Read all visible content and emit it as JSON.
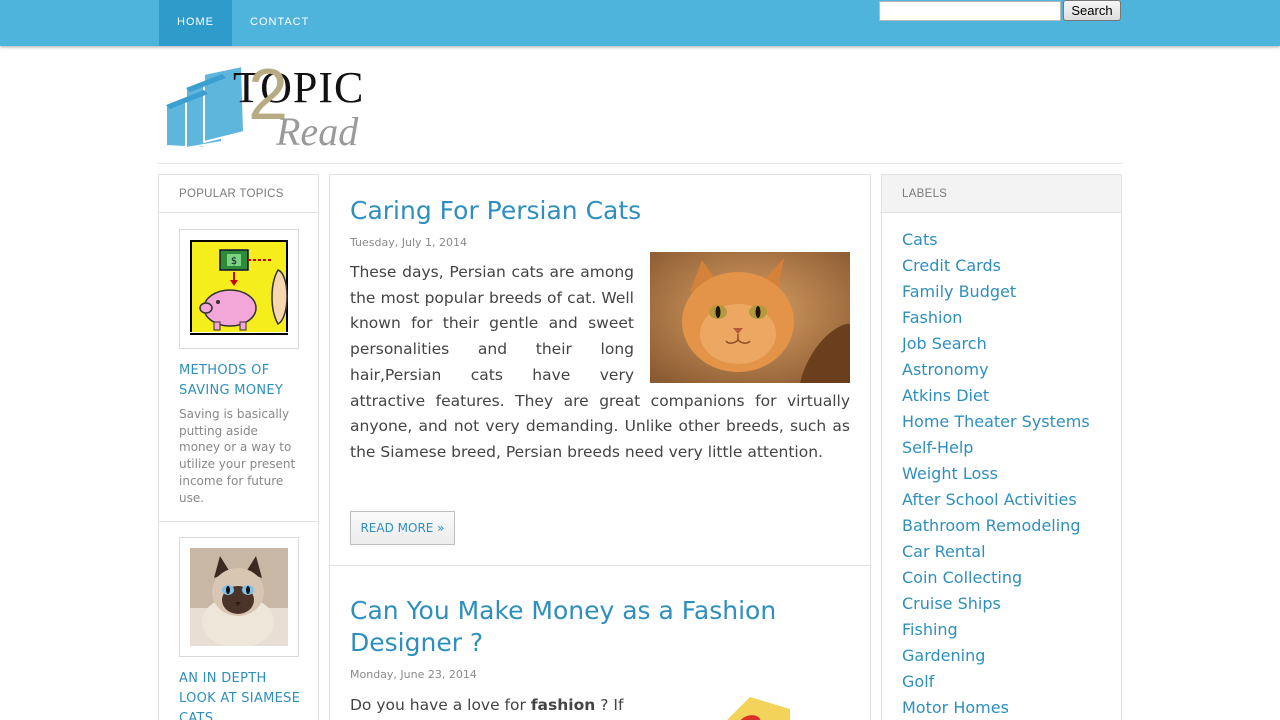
{
  "nav": {
    "items": [
      {
        "label": "HOME",
        "active": true
      },
      {
        "label": "CONTACT",
        "active": false
      }
    ],
    "search": {
      "value": "",
      "button_label": "Search"
    },
    "colors": {
      "bar": "#4fb4dc",
      "active": "#2e9bcb"
    }
  },
  "logo": {
    "text_topic": "TOPIC",
    "text_two": "2",
    "text_read": "Read",
    "icon": "books-logo-icon"
  },
  "left_sidebar": {
    "title": "POPULAR TOPICS",
    "items": [
      {
        "title": "METHODS OF SAVING MONEY",
        "description": "Saving is basically putting aside money or a way to utilize your present income for future use.",
        "thumb_icon": "piggy-bank-icon"
      },
      {
        "title": "AN IN DEPTH LOOK AT SIAMESE CATS",
        "description": "",
        "thumb_icon": "siamese-cat-photo"
      }
    ]
  },
  "posts": [
    {
      "title": "Caring For Persian Cats",
      "date": "Tuesday, July 1, 2014",
      "body": "These days, Persian cats are among the most popular breeds of cat.  Well known for their gentle and sweet personalities and their long hair,Persian cats have very attractive features. They are great companions for virtually anyone, and not very demanding. Unlike other breeds, such as the Siamese breed, Persian breeds need very little attention.",
      "image_icon": "persian-cat-photo",
      "read_more": "READ MORE »"
    },
    {
      "title": "Can You Make Money as a Fashion Designer ?",
      "date": "Monday, June 23, 2014",
      "body_start": "Do you have a love for",
      "body_bold": "fashion",
      "body_end": "? If",
      "image_icon": "fashion-illustration"
    }
  ],
  "right_sidebar": {
    "title": "LABELS",
    "labels": [
      "Cats",
      "Credit Cards",
      "Family Budget",
      "Fashion",
      "Job Search",
      "Astronomy",
      "Atkins Diet",
      "Home Theater Systems",
      "Self-Help",
      "Weight Loss",
      "After School Activities",
      "Bathroom Remodeling",
      "Car Rental",
      "Coin Collecting",
      "Cruise Ships",
      "Fishing",
      "Gardening",
      "Golf",
      "Motor Homes"
    ]
  },
  "colors": {
    "link": "#2e8fbf",
    "text": "#444444",
    "muted": "#888888"
  }
}
